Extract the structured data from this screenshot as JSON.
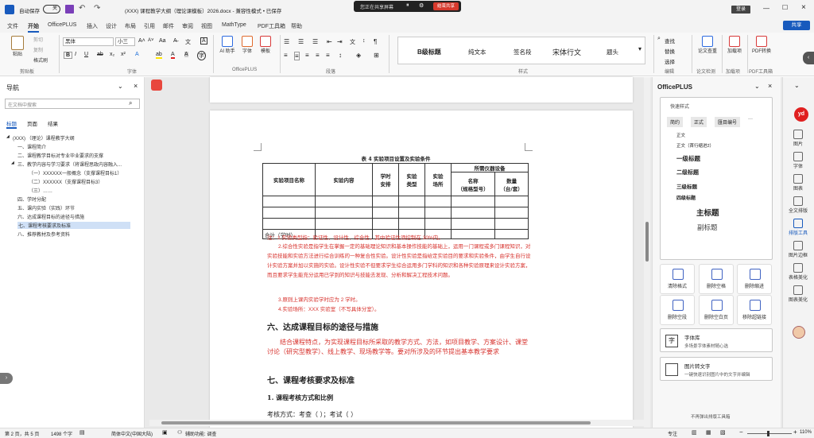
{
  "titlebar": {
    "autosave_label": "自动保存",
    "autosave_state": "关",
    "doc_title": "(XXX) 课程教学大纲（理论课模板）2026.docx  -  兼容性模式 • 已保存",
    "share_status": "您正在共享屏幕",
    "stop_share_label": "结束共享",
    "login_label": "登录"
  },
  "ribbon_tabs": [
    "文件",
    "开始",
    "OfficePLUS",
    "插入",
    "设计",
    "布局",
    "引用",
    "邮件",
    "审阅",
    "视图",
    "MathType",
    "PDF工具箱",
    "帮助"
  ],
  "share_button": "共享",
  "ribbon": {
    "clipboard": {
      "paste": "粘贴",
      "cut": "剪切",
      "copy": "复制",
      "format_painter": "格式刷",
      "group": "剪贴板"
    },
    "font": {
      "font_name": "黑体",
      "font_size": "小三",
      "group": "字体"
    },
    "officeplus": {
      "ai_assistant": "AI 助手",
      "font": "字体",
      "template": "模板",
      "group": "OfficePLUS"
    },
    "paragraph": {
      "group": "段落"
    },
    "styles": {
      "items": [
        "B级标题",
        "纯文本",
        "签名段",
        "宋体行文",
        "题头"
      ],
      "group": "样式"
    },
    "editing": {
      "find": "查找",
      "replace": "替换",
      "select": "选择",
      "group": "编辑"
    },
    "proofing": {
      "label": "论文查重",
      "group": "论文检测"
    },
    "addin": {
      "label": "加载项",
      "group": "加载项"
    },
    "pdf": {
      "label": "PDF转换",
      "group": "PDF工具箱"
    }
  },
  "nav_pane": {
    "title": "导航",
    "search_placeholder": "在文档中搜索",
    "tabs": [
      "标题",
      "页面",
      "结果"
    ],
    "items": [
      {
        "text": "(XXX) （理论）课程教学大纲",
        "level": 0
      },
      {
        "text": "一、课程简介",
        "level": 1
      },
      {
        "text": "二、课程教学目标对专业毕业要求的支撑",
        "level": 1
      },
      {
        "text": "三、教学内容与学习要求（将课程思政内容融入...",
        "level": 1
      },
      {
        "text": "（一）XXXXXX一般概念（支撑课程目标1）",
        "level": 2
      },
      {
        "text": "（二）XXXXXX（支撑课程目标3）",
        "level": 2
      },
      {
        "text": "（三）……",
        "level": 2
      },
      {
        "text": "四、学时分配",
        "level": 1
      },
      {
        "text": "五、课内实验（实践）环节",
        "level": 1
      },
      {
        "text": "六、达成课程目标的途径与措施",
        "level": 1
      },
      {
        "text": "七、课程考核要求及标准",
        "level": 1,
        "selected": true
      },
      {
        "text": "八、推荐教材及参考资料",
        "level": 1
      }
    ]
  },
  "document": {
    "table_caption": "表 4 实验项目设置及实验条件",
    "headers": {
      "project": "实验项目名称",
      "content": "实验内容",
      "hours": "学时\n安排",
      "type": "实验\n类型",
      "place": "实验\n场所",
      "equipment": "所需仪器设备",
      "name": "名称\n（规格型号）",
      "qty": "数量\n（台/套）"
    },
    "total_label": "合计（学时）",
    "notes": [
      "注：1.实验类型指：验证性、设计性、综合性，其中验证性须控制在 30%内。",
      "2.综合性实验是指学生在掌握一定的基础理论知识和基本操作技能的基础上，运用一门课程或多门课程知识，对实验技能和实验方法进行综合训练的一种复合性实验。设计性实验是指给定实验目的要求和实验条件，由学生自行设计实验方案并加以实施的实验。设计性实验不但要求学生综合运用多门学科的知识和各种实验原理来设计实验方案，而且要求学生能充分运用已学到的知识与技能去发现、分析和解决工程技术问题。",
      "3.原则上课内实验学时应为 2 学时。",
      "4.实验场所：XXX 实验室（不写具体分室）。"
    ],
    "section6_title": "六、达成课程目标的途径与措施",
    "section6_text": "结合课程特点，为实现课程目标所采取的教学方式、方法，如项目教学、方案设计、课堂讨论（研究型教学）、线上教学、现场教学等。要对所涉及的环节提出基本教学要求",
    "section7_title": "七、课程考核要求及标准",
    "sub1_title": "1.   课程考核方式和比例",
    "exam_line": "考核方式：考查（    ）；考试（    ）"
  },
  "officeplus_pane": {
    "title": "OfficePLUS",
    "quick_styles_label": "快速样式",
    "style_tabs": [
      "简约",
      "正式",
      "匯目编号",
      "···"
    ],
    "styles": [
      "正文",
      "正文（首行缩进2）",
      "一级标题",
      "二级标题",
      "三级标题",
      "四级标题",
      "主标题",
      "副标题"
    ],
    "tools": [
      "清除格式",
      "删除空格",
      "删除缩进",
      "删除空段",
      "删除空白页",
      "移除超链接"
    ],
    "font_lib_title": "字体库",
    "font_lib_desc": "多场景字体素材随心选",
    "img2text_title": "图片转文字",
    "img2text_desc": "一键快速识别图片中的文字并编辑",
    "footer": "不再弹出排版工具箱"
  },
  "right_rail": [
    "图片",
    "字体",
    "图表",
    "全文排版",
    "排版工具",
    "图片边框",
    "表格美化",
    "图表美化"
  ],
  "statusbar": {
    "page": "第 2 页，共 5 页",
    "words": "1498 个字",
    "language": "简体中文(中国大陆)",
    "accessibility": "辅助功能: 调查",
    "focus": "专注",
    "zoom": "110%"
  }
}
